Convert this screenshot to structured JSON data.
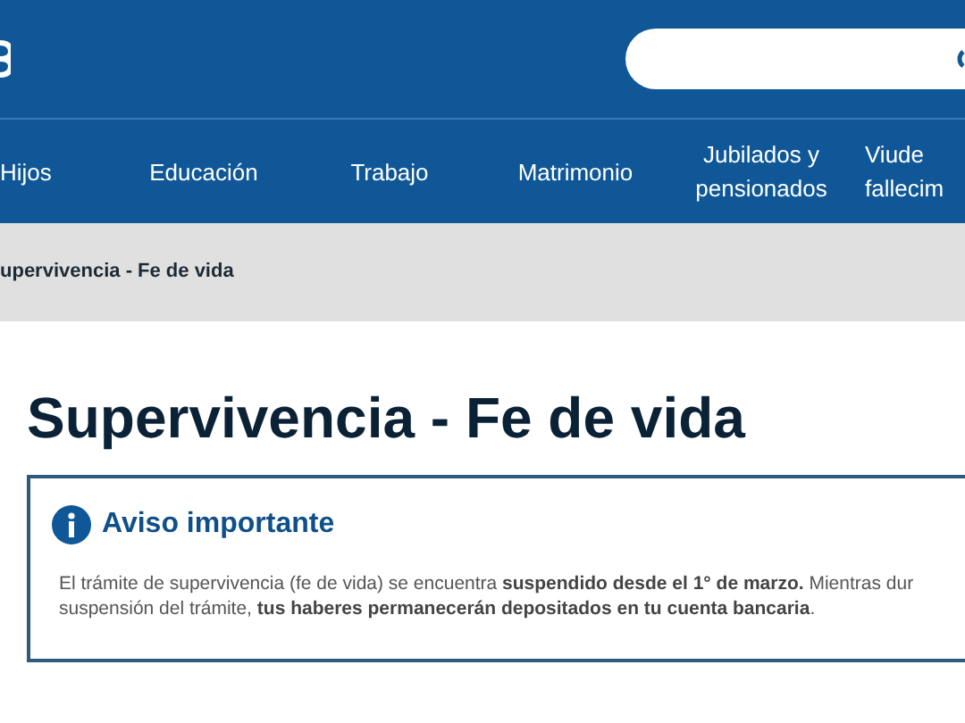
{
  "nav": [
    {
      "label": "Hijos"
    },
    {
      "label": "Educación"
    },
    {
      "label": "Trabajo"
    },
    {
      "label": "Matrimonio"
    },
    {
      "label": "Jubilados y pensionados"
    },
    {
      "label": "Viude fallecim"
    }
  ],
  "breadcrumb": "upervivencia - Fe de vida",
  "title": "Supervivencia - Fe de vida",
  "notice": {
    "title": "Aviso importante",
    "lines": [
      "El trámite de supervivencia (fe de vida) se encuentra **suspendido desde el 1° de marzo.** Mientras dur",
      "suspensión del trámite, **tus haberes permanecerán depositados en tu cuenta bancaria**."
    ]
  }
}
